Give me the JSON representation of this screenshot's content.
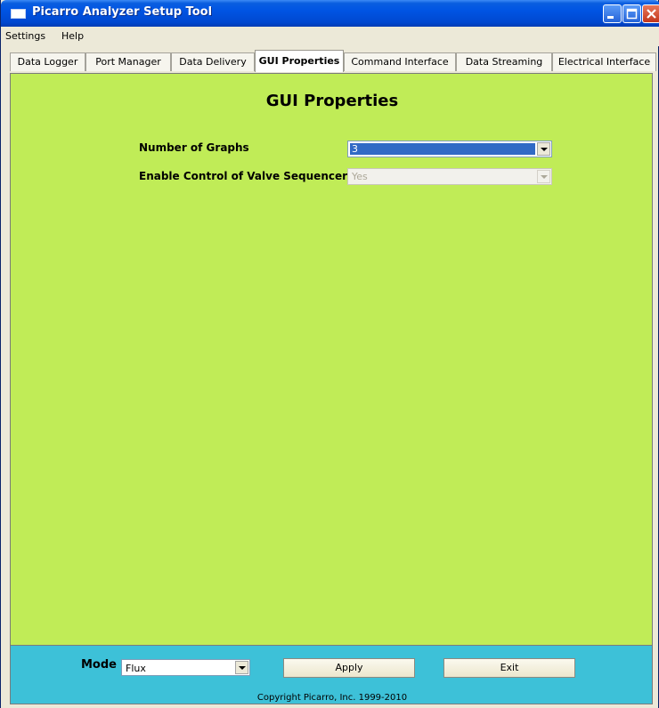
{
  "window": {
    "title": "Picarro Analyzer Setup Tool"
  },
  "menubar": {
    "items": [
      "Settings",
      "Help"
    ]
  },
  "tabs": [
    {
      "label": "Data Logger",
      "active": false
    },
    {
      "label": "Port Manager",
      "active": false
    },
    {
      "label": "Data Delivery",
      "active": false
    },
    {
      "label": "GUI Properties",
      "active": true
    },
    {
      "label": "Command Interface",
      "active": false
    },
    {
      "label": "Data Streaming",
      "active": false
    },
    {
      "label": "Electrical Interface",
      "active": false
    }
  ],
  "main": {
    "title": "GUI Properties",
    "fields": [
      {
        "label": "Number of Graphs",
        "value": "3",
        "enabled": true
      },
      {
        "label": "Enable Control of Valve Sequencer",
        "value": "Yes",
        "enabled": false
      }
    ]
  },
  "footer": {
    "mode_label": "Mode",
    "mode_value": "Flux",
    "apply_label": "Apply",
    "exit_label": "Exit",
    "copyright": "Copyright Picarro, Inc. 1999-2010"
  },
  "colors": {
    "content_bg": "#c0ec57",
    "footer_bg": "#3dc1d8",
    "titlebar": "#0054e3",
    "selection": "#316ac5"
  },
  "icons": {
    "app": "app-window-icon",
    "minimize": "minimize-icon",
    "maximize": "maximize-icon",
    "close": "close-icon",
    "dropdown": "chevron-down-icon"
  }
}
